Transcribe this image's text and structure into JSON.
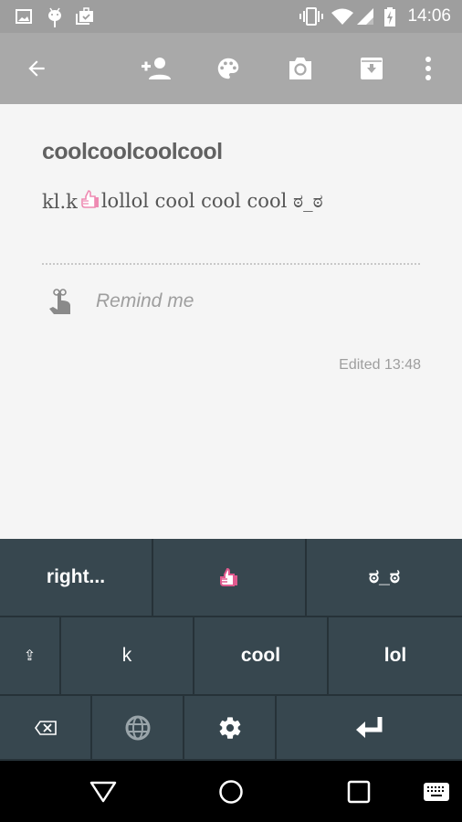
{
  "status_bar": {
    "time": "14:06",
    "left_icons": [
      "image-icon",
      "android-icon",
      "clipboard-check-icon"
    ],
    "right_icons": [
      "vibrate-icon",
      "wifi-icon",
      "signal-icon",
      "battery-charging-icon"
    ]
  },
  "toolbar": {
    "actions": [
      "back",
      "add-collaborator",
      "color-palette",
      "add-image",
      "archive",
      "more-options"
    ]
  },
  "note": {
    "title": "coolcoolcoolcool",
    "body_before_emoji": "kl.k",
    "body_emoji": "thumbs-up",
    "body_after_emoji": "lollol cool cool cool ಠ_ಠ",
    "remind_label": "Remind me",
    "edited": "Edited 13:48"
  },
  "keyboard": {
    "suggestions": [
      "right...",
      "👍",
      "ಠ_ಠ"
    ],
    "row2": [
      "⇪",
      "k",
      "cool",
      "lol"
    ],
    "row3": [
      "backspace",
      "globe",
      "settings",
      "enter"
    ],
    "colors": {
      "key_bg": "#37474f",
      "gap": "#263238",
      "accent_emoji": "#e05a8e"
    }
  },
  "nav_bar": {
    "buttons": [
      "back",
      "home",
      "recents",
      "keyboard"
    ]
  }
}
